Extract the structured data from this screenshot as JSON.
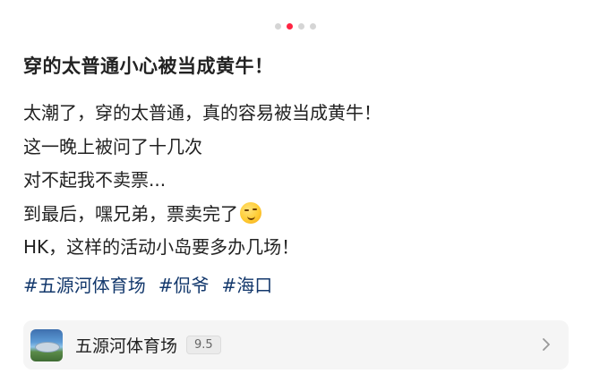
{
  "carousel": {
    "count": 4,
    "active_index": 1
  },
  "post": {
    "title": "穿的太普通小心被当成黄牛！",
    "lines": [
      "太潮了，穿的太普通，真的容易被当成黄牛！",
      "这一晚上被问了十几次",
      "对不起我不卖票...",
      "到最后，嘿兄弟，票卖完了",
      "HK，这样的活动小岛要多办几场！"
    ],
    "emoji": "smirking-face",
    "tags": [
      "#五源河体育场",
      "#侃爷",
      "#海口"
    ]
  },
  "location": {
    "name": "五源河体育场",
    "rating": "9.5"
  },
  "colors": {
    "accent": "#ff2442",
    "tag": "#13386c",
    "text": "#222222"
  }
}
